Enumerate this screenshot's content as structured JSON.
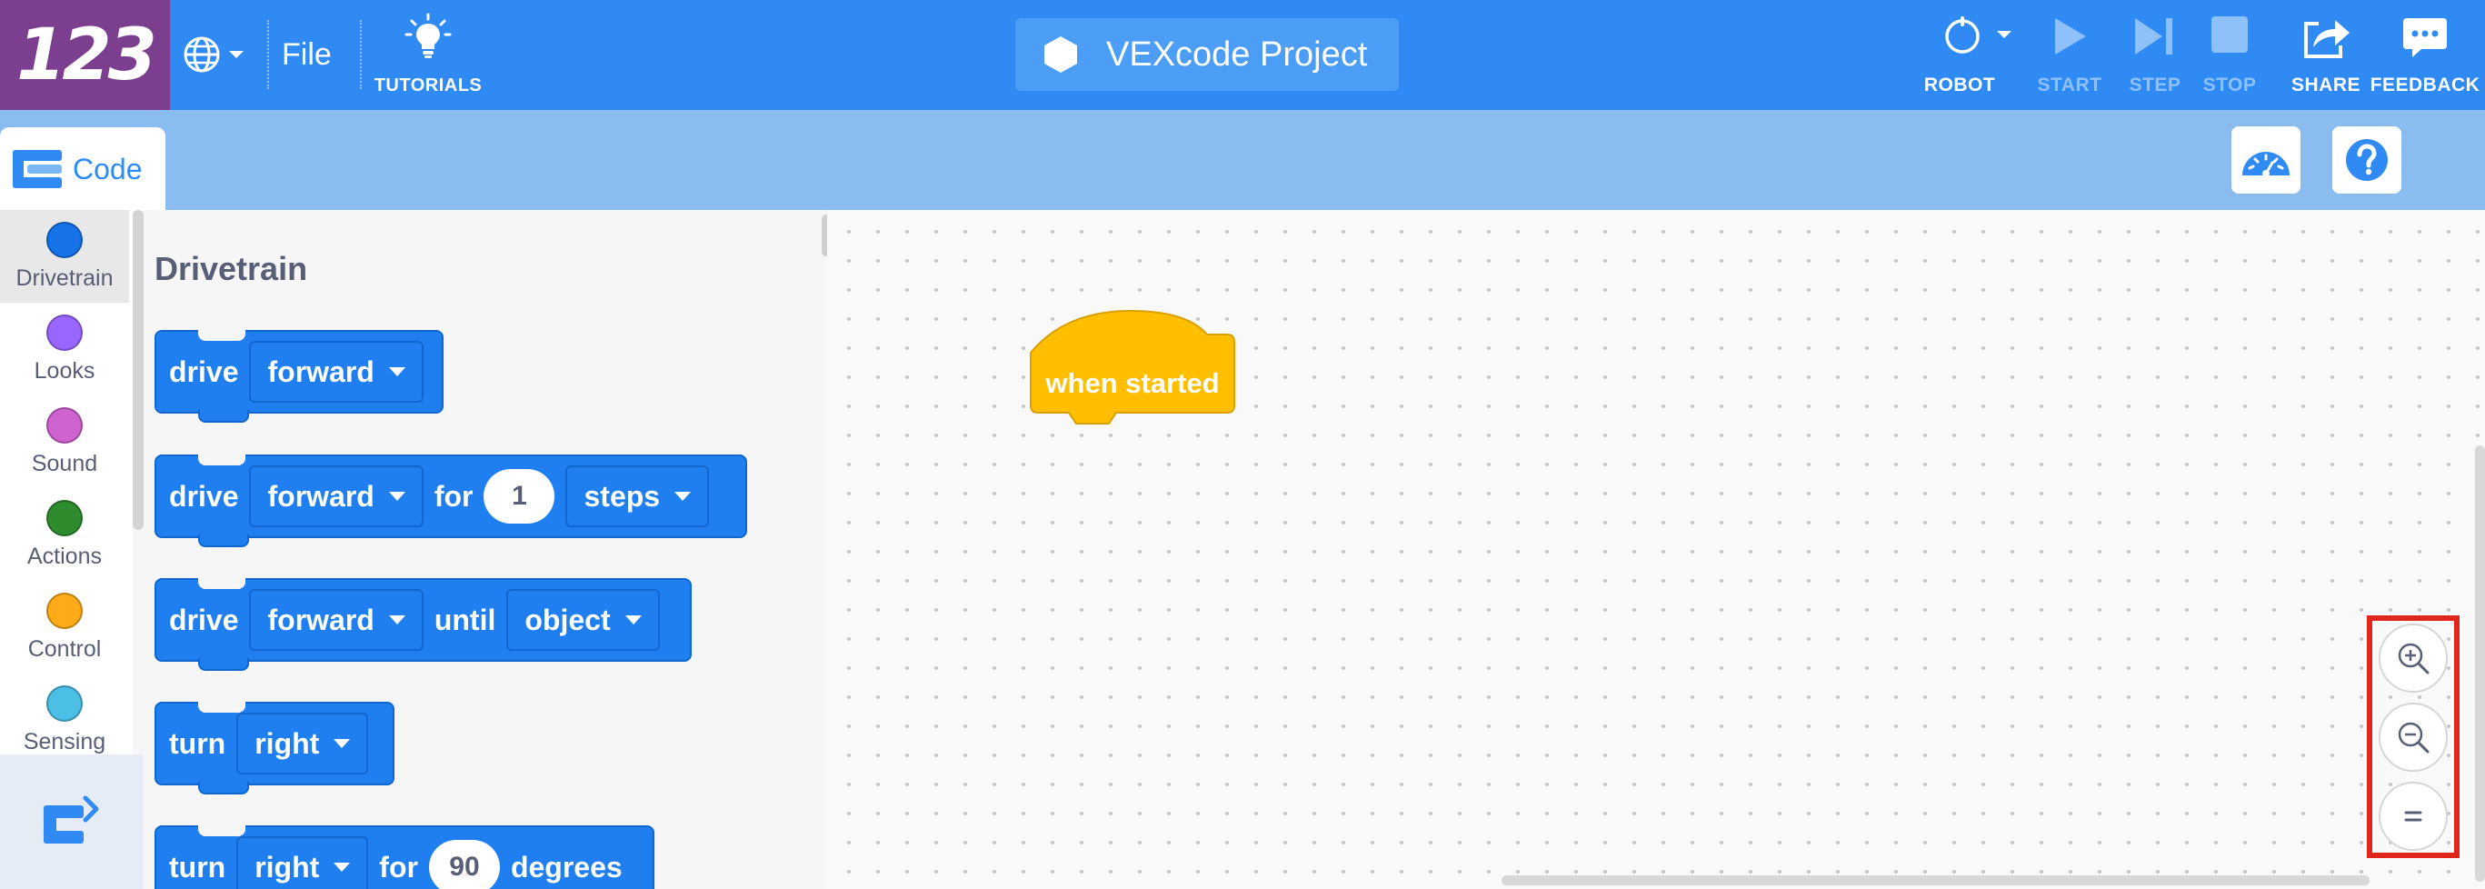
{
  "header": {
    "logo_text": "123",
    "file_label": "File",
    "tutorials_label": "TUTORIALS",
    "project_name": "VEXcode Project",
    "actions": {
      "robot": "ROBOT",
      "start": "START",
      "step": "STEP",
      "stop": "STOP",
      "share": "SHARE",
      "feedback": "FEEDBACK"
    }
  },
  "tabs": {
    "code": "Code"
  },
  "categories": [
    {
      "label": "Drivetrain",
      "color": "#1672e8"
    },
    {
      "label": "Looks",
      "color": "#9966ff"
    },
    {
      "label": "Sound",
      "color": "#cf63cf"
    },
    {
      "label": "Actions",
      "color": "#2e8b2e"
    },
    {
      "label": "Control",
      "color": "#ffab19"
    },
    {
      "label": "Sensing",
      "color": "#4cbfe6"
    }
  ],
  "flyout": {
    "title": "Drivetrain",
    "blocks": [
      {
        "b0": "drive",
        "d0": "forward"
      },
      {
        "b0": "drive",
        "d0": "forward",
        "t1": "for",
        "n0": "1",
        "d1": "steps"
      },
      {
        "b0": "drive",
        "d0": "forward",
        "t1": "until",
        "d1": "object"
      },
      {
        "b0": "turn",
        "d0": "right"
      },
      {
        "b0": "turn",
        "d0": "right",
        "t1": "for",
        "n0": "90",
        "t2": "degrees"
      }
    ]
  },
  "workspace": {
    "hat_label": "when started"
  },
  "colors": {
    "topbar": "#2f8bf3",
    "logo": "#7c3f8f",
    "block": "#1f7ff0",
    "hat": "#ffbf00",
    "highlight": "#e0261b"
  },
  "icons": [
    "globe-icon",
    "lightbulb-icon",
    "hexagon-icon",
    "robot-icon",
    "play-icon",
    "step-icon",
    "stop-icon",
    "share-icon",
    "feedback-icon",
    "dashboard-icon",
    "help-icon",
    "zoom-in-icon",
    "zoom-out-icon",
    "zoom-reset-icon",
    "extensions-icon"
  ]
}
